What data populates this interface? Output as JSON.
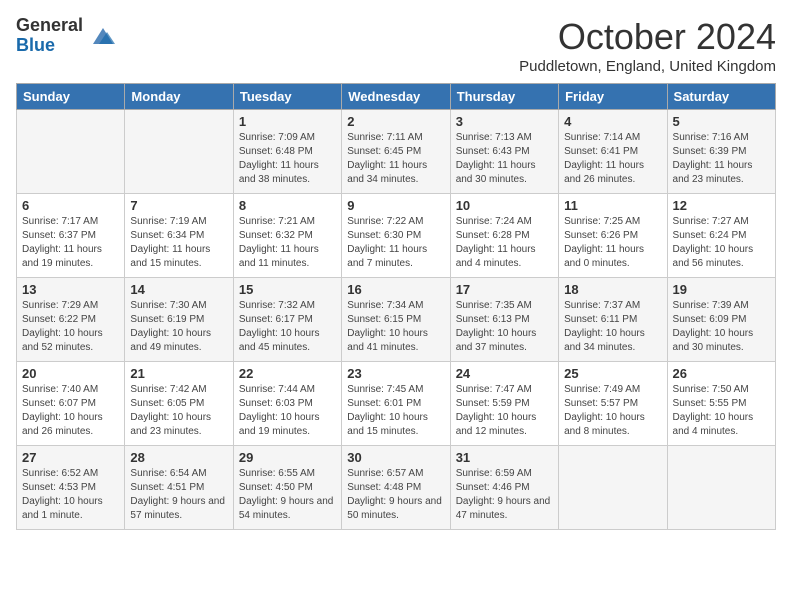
{
  "logo": {
    "general": "General",
    "blue": "Blue"
  },
  "title": "October 2024",
  "location": "Puddletown, England, United Kingdom",
  "days_of_week": [
    "Sunday",
    "Monday",
    "Tuesday",
    "Wednesday",
    "Thursday",
    "Friday",
    "Saturday"
  ],
  "weeks": [
    [
      {
        "day": "",
        "sunrise": "",
        "sunset": "",
        "daylight": ""
      },
      {
        "day": "",
        "sunrise": "",
        "sunset": "",
        "daylight": ""
      },
      {
        "day": "1",
        "sunrise": "Sunrise: 7:09 AM",
        "sunset": "Sunset: 6:48 PM",
        "daylight": "Daylight: 11 hours and 38 minutes."
      },
      {
        "day": "2",
        "sunrise": "Sunrise: 7:11 AM",
        "sunset": "Sunset: 6:45 PM",
        "daylight": "Daylight: 11 hours and 34 minutes."
      },
      {
        "day": "3",
        "sunrise": "Sunrise: 7:13 AM",
        "sunset": "Sunset: 6:43 PM",
        "daylight": "Daylight: 11 hours and 30 minutes."
      },
      {
        "day": "4",
        "sunrise": "Sunrise: 7:14 AM",
        "sunset": "Sunset: 6:41 PM",
        "daylight": "Daylight: 11 hours and 26 minutes."
      },
      {
        "day": "5",
        "sunrise": "Sunrise: 7:16 AM",
        "sunset": "Sunset: 6:39 PM",
        "daylight": "Daylight: 11 hours and 23 minutes."
      }
    ],
    [
      {
        "day": "6",
        "sunrise": "Sunrise: 7:17 AM",
        "sunset": "Sunset: 6:37 PM",
        "daylight": "Daylight: 11 hours and 19 minutes."
      },
      {
        "day": "7",
        "sunrise": "Sunrise: 7:19 AM",
        "sunset": "Sunset: 6:34 PM",
        "daylight": "Daylight: 11 hours and 15 minutes."
      },
      {
        "day": "8",
        "sunrise": "Sunrise: 7:21 AM",
        "sunset": "Sunset: 6:32 PM",
        "daylight": "Daylight: 11 hours and 11 minutes."
      },
      {
        "day": "9",
        "sunrise": "Sunrise: 7:22 AM",
        "sunset": "Sunset: 6:30 PM",
        "daylight": "Daylight: 11 hours and 7 minutes."
      },
      {
        "day": "10",
        "sunrise": "Sunrise: 7:24 AM",
        "sunset": "Sunset: 6:28 PM",
        "daylight": "Daylight: 11 hours and 4 minutes."
      },
      {
        "day": "11",
        "sunrise": "Sunrise: 7:25 AM",
        "sunset": "Sunset: 6:26 PM",
        "daylight": "Daylight: 11 hours and 0 minutes."
      },
      {
        "day": "12",
        "sunrise": "Sunrise: 7:27 AM",
        "sunset": "Sunset: 6:24 PM",
        "daylight": "Daylight: 10 hours and 56 minutes."
      }
    ],
    [
      {
        "day": "13",
        "sunrise": "Sunrise: 7:29 AM",
        "sunset": "Sunset: 6:22 PM",
        "daylight": "Daylight: 10 hours and 52 minutes."
      },
      {
        "day": "14",
        "sunrise": "Sunrise: 7:30 AM",
        "sunset": "Sunset: 6:19 PM",
        "daylight": "Daylight: 10 hours and 49 minutes."
      },
      {
        "day": "15",
        "sunrise": "Sunrise: 7:32 AM",
        "sunset": "Sunset: 6:17 PM",
        "daylight": "Daylight: 10 hours and 45 minutes."
      },
      {
        "day": "16",
        "sunrise": "Sunrise: 7:34 AM",
        "sunset": "Sunset: 6:15 PM",
        "daylight": "Daylight: 10 hours and 41 minutes."
      },
      {
        "day": "17",
        "sunrise": "Sunrise: 7:35 AM",
        "sunset": "Sunset: 6:13 PM",
        "daylight": "Daylight: 10 hours and 37 minutes."
      },
      {
        "day": "18",
        "sunrise": "Sunrise: 7:37 AM",
        "sunset": "Sunset: 6:11 PM",
        "daylight": "Daylight: 10 hours and 34 minutes."
      },
      {
        "day": "19",
        "sunrise": "Sunrise: 7:39 AM",
        "sunset": "Sunset: 6:09 PM",
        "daylight": "Daylight: 10 hours and 30 minutes."
      }
    ],
    [
      {
        "day": "20",
        "sunrise": "Sunrise: 7:40 AM",
        "sunset": "Sunset: 6:07 PM",
        "daylight": "Daylight: 10 hours and 26 minutes."
      },
      {
        "day": "21",
        "sunrise": "Sunrise: 7:42 AM",
        "sunset": "Sunset: 6:05 PM",
        "daylight": "Daylight: 10 hours and 23 minutes."
      },
      {
        "day": "22",
        "sunrise": "Sunrise: 7:44 AM",
        "sunset": "Sunset: 6:03 PM",
        "daylight": "Daylight: 10 hours and 19 minutes."
      },
      {
        "day": "23",
        "sunrise": "Sunrise: 7:45 AM",
        "sunset": "Sunset: 6:01 PM",
        "daylight": "Daylight: 10 hours and 15 minutes."
      },
      {
        "day": "24",
        "sunrise": "Sunrise: 7:47 AM",
        "sunset": "Sunset: 5:59 PM",
        "daylight": "Daylight: 10 hours and 12 minutes."
      },
      {
        "day": "25",
        "sunrise": "Sunrise: 7:49 AM",
        "sunset": "Sunset: 5:57 PM",
        "daylight": "Daylight: 10 hours and 8 minutes."
      },
      {
        "day": "26",
        "sunrise": "Sunrise: 7:50 AM",
        "sunset": "Sunset: 5:55 PM",
        "daylight": "Daylight: 10 hours and 4 minutes."
      }
    ],
    [
      {
        "day": "27",
        "sunrise": "Sunrise: 6:52 AM",
        "sunset": "Sunset: 4:53 PM",
        "daylight": "Daylight: 10 hours and 1 minute."
      },
      {
        "day": "28",
        "sunrise": "Sunrise: 6:54 AM",
        "sunset": "Sunset: 4:51 PM",
        "daylight": "Daylight: 9 hours and 57 minutes."
      },
      {
        "day": "29",
        "sunrise": "Sunrise: 6:55 AM",
        "sunset": "Sunset: 4:50 PM",
        "daylight": "Daylight: 9 hours and 54 minutes."
      },
      {
        "day": "30",
        "sunrise": "Sunrise: 6:57 AM",
        "sunset": "Sunset: 4:48 PM",
        "daylight": "Daylight: 9 hours and 50 minutes."
      },
      {
        "day": "31",
        "sunrise": "Sunrise: 6:59 AM",
        "sunset": "Sunset: 4:46 PM",
        "daylight": "Daylight: 9 hours and 47 minutes."
      },
      {
        "day": "",
        "sunrise": "",
        "sunset": "",
        "daylight": ""
      },
      {
        "day": "",
        "sunrise": "",
        "sunset": "",
        "daylight": ""
      }
    ]
  ]
}
